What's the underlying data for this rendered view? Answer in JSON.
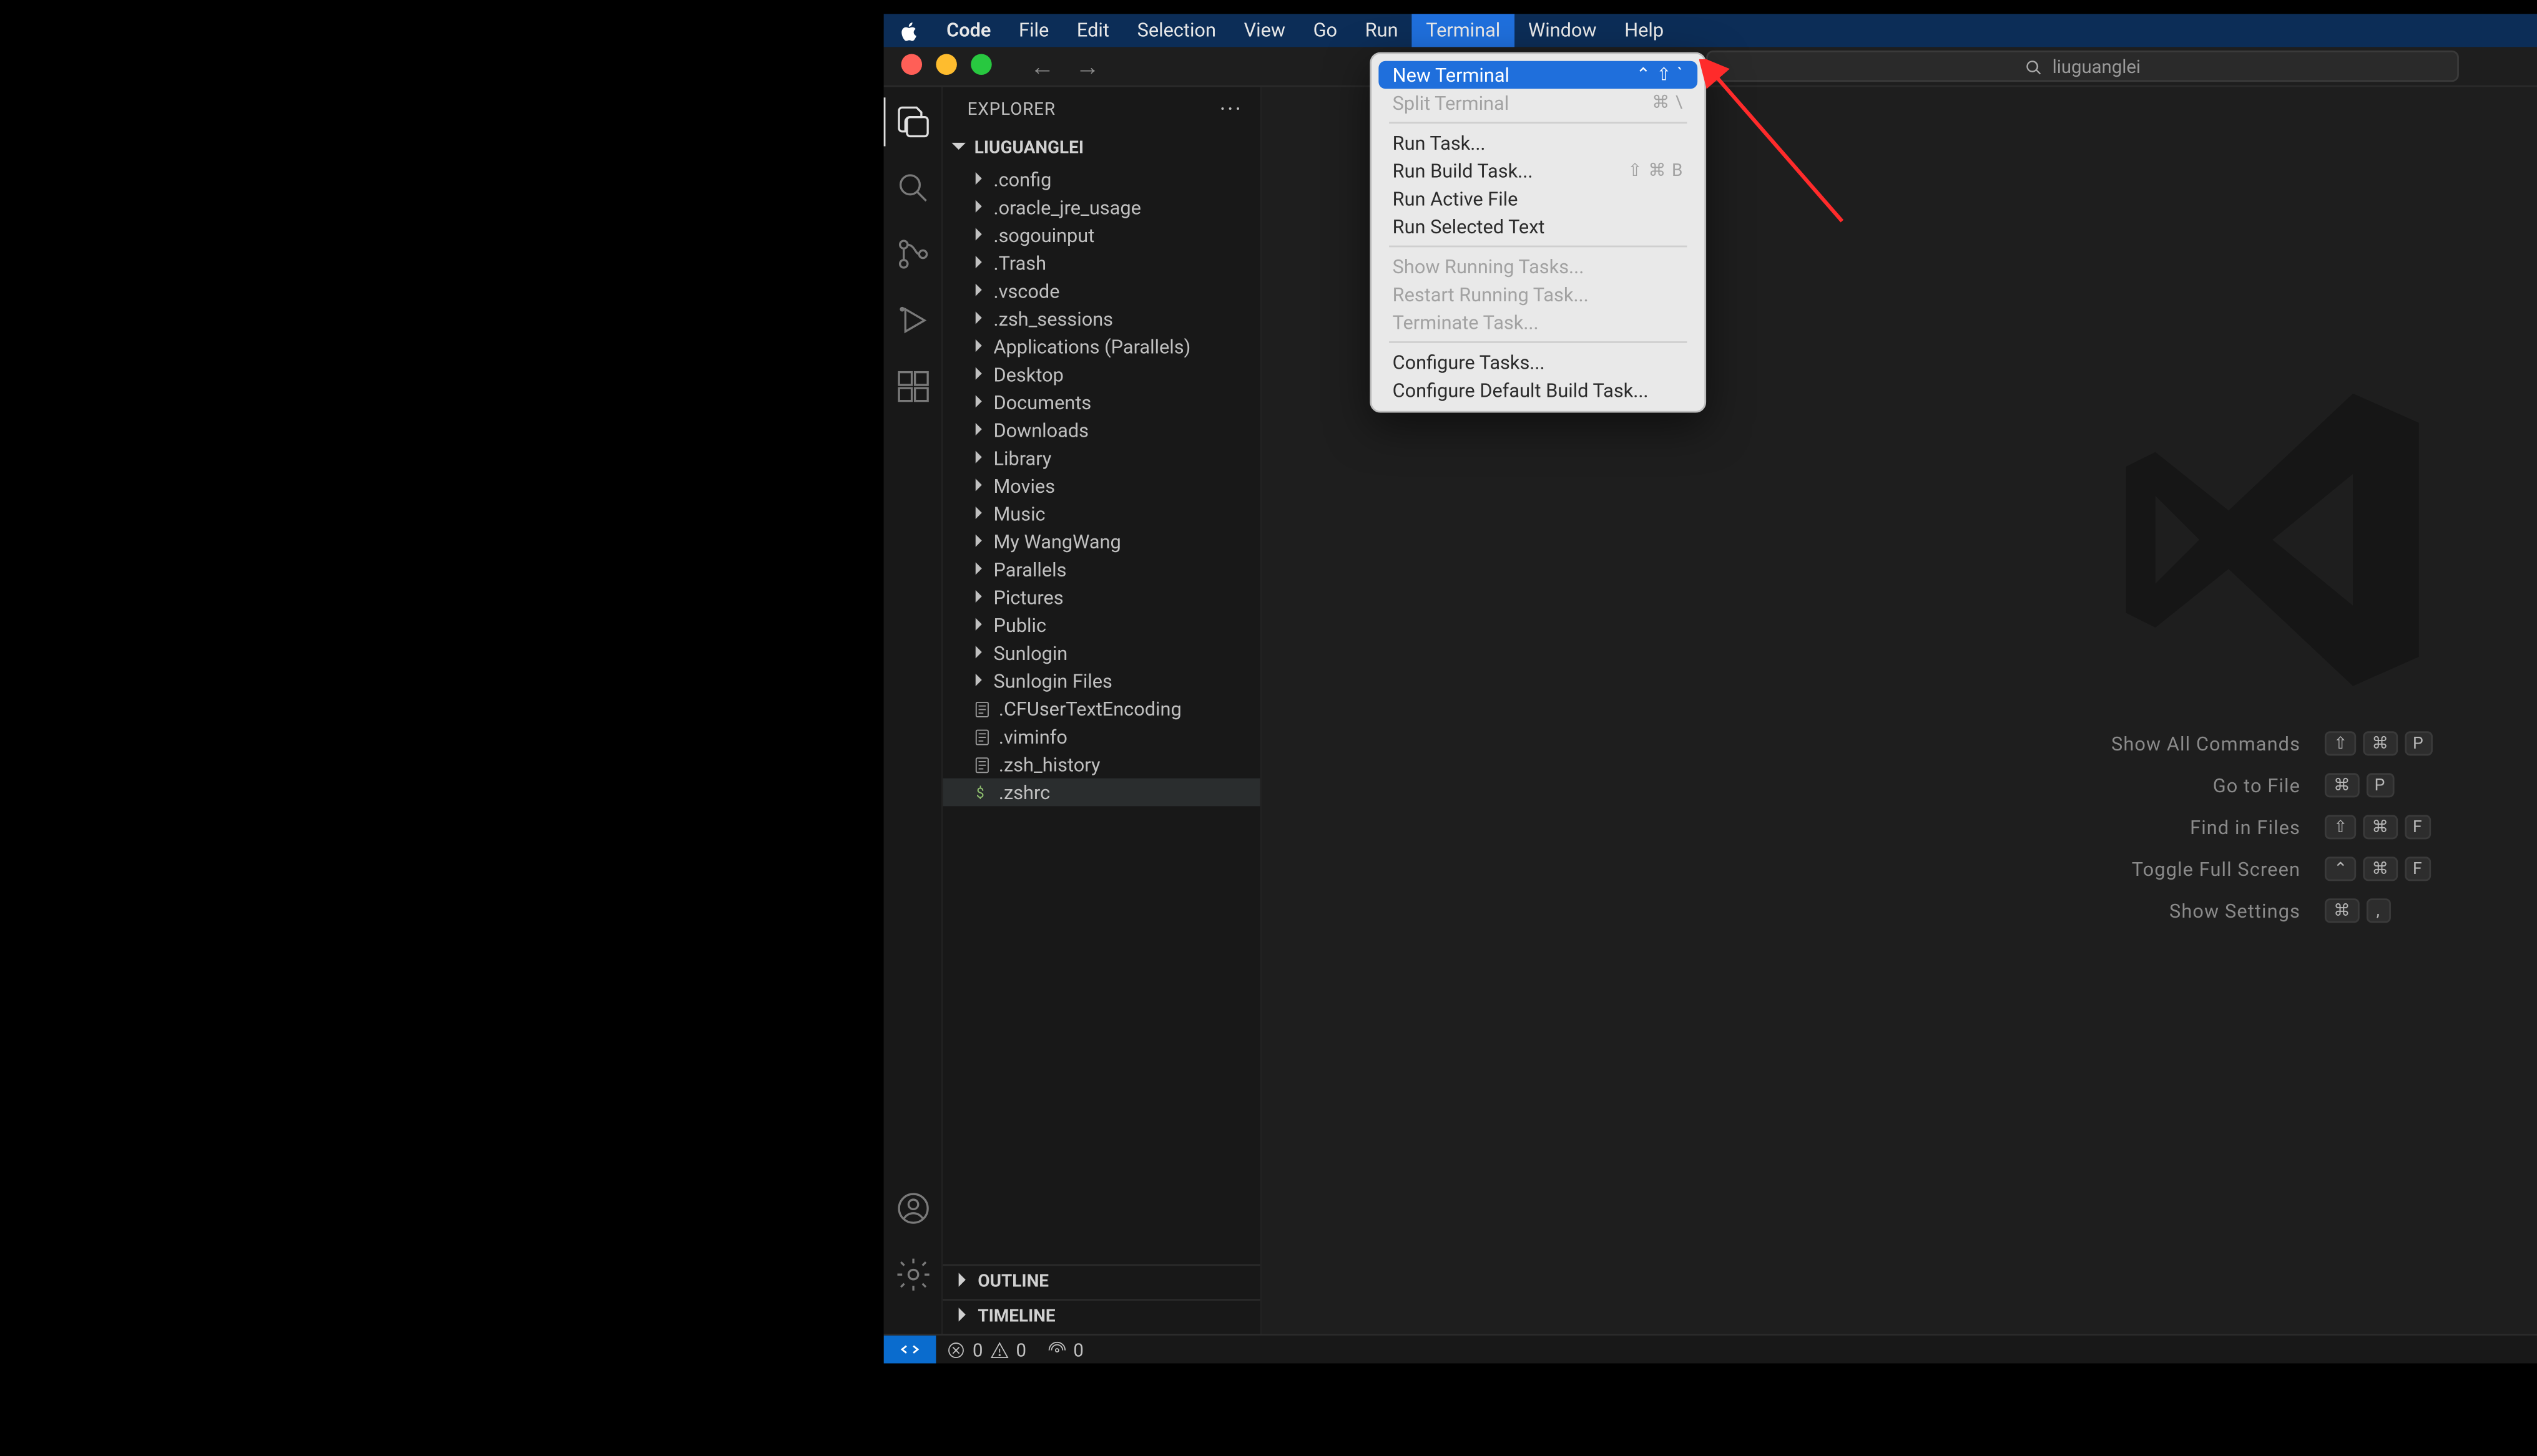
{
  "mac_menu": {
    "app": "Code",
    "items": [
      "File",
      "Edit",
      "Selection",
      "View",
      "Go",
      "Run",
      "Terminal",
      "Window",
      "Help"
    ],
    "active": "Terminal"
  },
  "titlebar": {
    "nav_back": "←",
    "nav_fwd": "→",
    "search_text": "liuguanglei"
  },
  "explorer": {
    "title": "EXPLORER",
    "root": "LIUGUANGLEI",
    "folders": [
      ".config",
      ".oracle_jre_usage",
      ".sogouinput",
      ".Trash",
      ".vscode",
      ".zsh_sessions",
      "Applications (Parallels)",
      "Desktop",
      "Documents",
      "Downloads",
      "Library",
      "Movies",
      "Music",
      "My WangWang",
      "Parallels",
      "Pictures",
      "Public",
      "Sunlogin",
      "Sunlogin Files"
    ],
    "files": [
      {
        "name": ".CFUserTextEncoding",
        "icon": "text"
      },
      {
        "name": ".viminfo",
        "icon": "text"
      },
      {
        "name": ".zsh_history",
        "icon": "text"
      },
      {
        "name": ".zshrc",
        "icon": "dollar",
        "selected": true
      }
    ],
    "outline": "OUTLINE",
    "timeline": "TIMELINE"
  },
  "dropdown": {
    "groups": [
      [
        {
          "label": "New Terminal",
          "shortcut": "⌃ ⇧ `",
          "hl": true
        },
        {
          "label": "Split Terminal",
          "shortcut": "⌘ \\",
          "disabled": true
        }
      ],
      [
        {
          "label": "Run Task..."
        },
        {
          "label": "Run Build Task...",
          "shortcut": "⇧ ⌘ B",
          "sc_muted": true
        },
        {
          "label": "Run Active File"
        },
        {
          "label": "Run Selected Text"
        }
      ],
      [
        {
          "label": "Show Running Tasks...",
          "disabled": true
        },
        {
          "label": "Restart Running Task...",
          "disabled": true
        },
        {
          "label": "Terminate Task...",
          "disabled": true
        }
      ],
      [
        {
          "label": "Configure Tasks..."
        },
        {
          "label": "Configure Default Build Task..."
        }
      ]
    ]
  },
  "welcome": {
    "shortcuts": [
      {
        "label": "Show All Commands",
        "keys": [
          "⇧",
          "⌘",
          "P"
        ]
      },
      {
        "label": "Go to File",
        "keys": [
          "⌘",
          "P"
        ]
      },
      {
        "label": "Find in Files",
        "keys": [
          "⇧",
          "⌘",
          "F"
        ]
      },
      {
        "label": "Toggle Full Screen",
        "keys": [
          "⌃",
          "⌘",
          "F"
        ]
      },
      {
        "label": "Show Settings",
        "keys": [
          "⌘",
          ","
        ]
      }
    ]
  },
  "status": {
    "errors": "0",
    "warnings": "0",
    "ports_label": "0"
  }
}
